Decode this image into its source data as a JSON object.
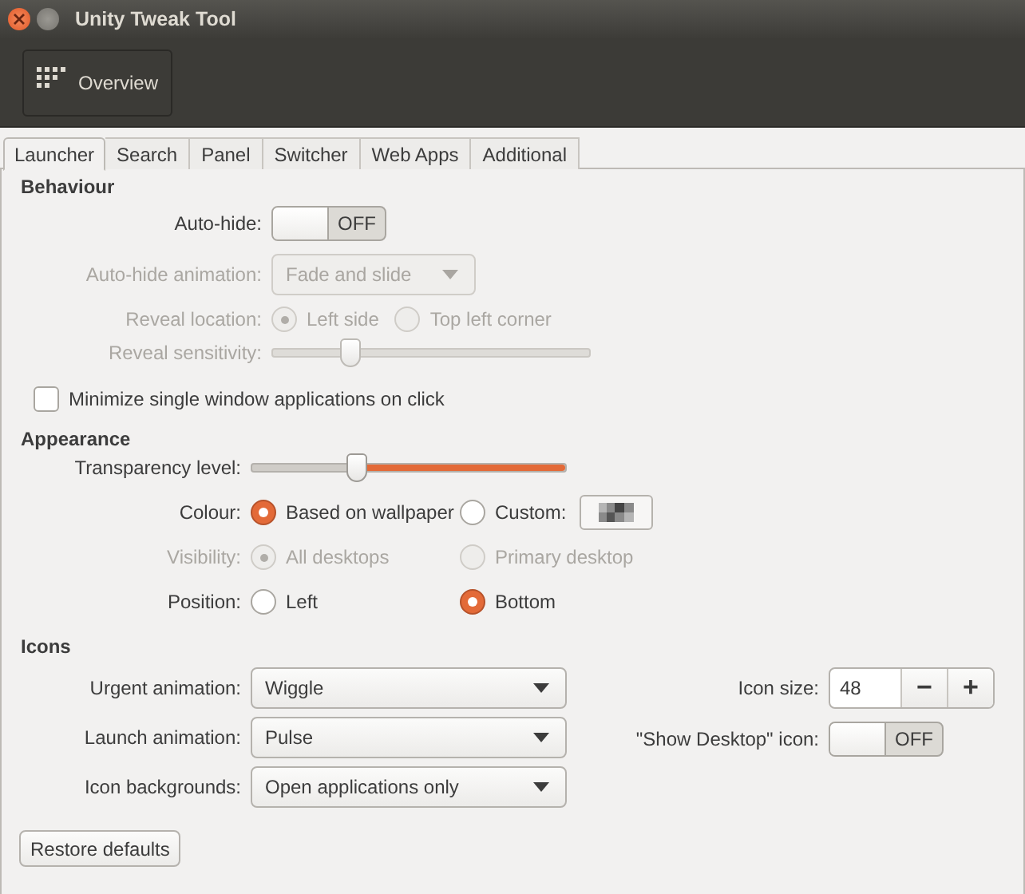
{
  "window": {
    "title": "Unity Tweak Tool"
  },
  "toolbar": {
    "overview_button": "Overview"
  },
  "tabs": [
    {
      "label": "Launcher",
      "selected": true
    },
    {
      "label": "Search",
      "selected": false
    },
    {
      "label": "Panel",
      "selected": false
    },
    {
      "label": "Switcher",
      "selected": false
    },
    {
      "label": "Web Apps",
      "selected": false
    },
    {
      "label": "Additional",
      "selected": false
    }
  ],
  "behaviour": {
    "heading": "Behaviour",
    "auto_hide": {
      "label": "Auto-hide:",
      "on": false,
      "state_text": "OFF"
    },
    "auto_hide_animation": {
      "label": "Auto-hide animation:",
      "value": "Fade and slide",
      "disabled": true
    },
    "reveal_location": {
      "label": "Reveal location:",
      "disabled": true,
      "options": [
        {
          "label": "Left side",
          "selected": true
        },
        {
          "label": "Top left corner",
          "selected": false
        }
      ]
    },
    "reveal_sensitivity": {
      "label": "Reveal sensitivity:",
      "disabled": true,
      "level": 0.25
    },
    "minimize_single_window": {
      "label": "Minimize single window applications on click",
      "checked": false
    }
  },
  "appearance": {
    "heading": "Appearance",
    "transparency": {
      "label": "Transparency level:",
      "level": 0.34
    },
    "colour": {
      "label": "Colour:",
      "disabled": false,
      "options": [
        {
          "label": "Based on wallpaper",
          "selected": true
        },
        {
          "label": "Custom:",
          "selected": false
        }
      ]
    },
    "visibility": {
      "label": "Visibility:",
      "disabled": true,
      "options": [
        {
          "label": "All desktops",
          "selected": true
        },
        {
          "label": "Primary desktop",
          "selected": false
        }
      ]
    },
    "position": {
      "label": "Position:",
      "disabled": false,
      "options": [
        {
          "label": "Left",
          "selected": false
        },
        {
          "label": "Bottom",
          "selected": true
        }
      ]
    }
  },
  "icons": {
    "heading": "Icons",
    "dropdowns": [
      {
        "label": "Urgent animation:",
        "value": "Wiggle"
      },
      {
        "label": "Launch animation:",
        "value": "Pulse"
      },
      {
        "label": "Icon backgrounds:",
        "value": "Open applications only"
      }
    ],
    "icon_size": {
      "label": "Icon size:",
      "value": "48",
      "decrement": "−",
      "increment": "+"
    },
    "show_desktop": {
      "label": "\"Show Desktop\" icon:",
      "on": false,
      "state_text": "OFF"
    }
  },
  "restore_button": "Restore defaults"
}
